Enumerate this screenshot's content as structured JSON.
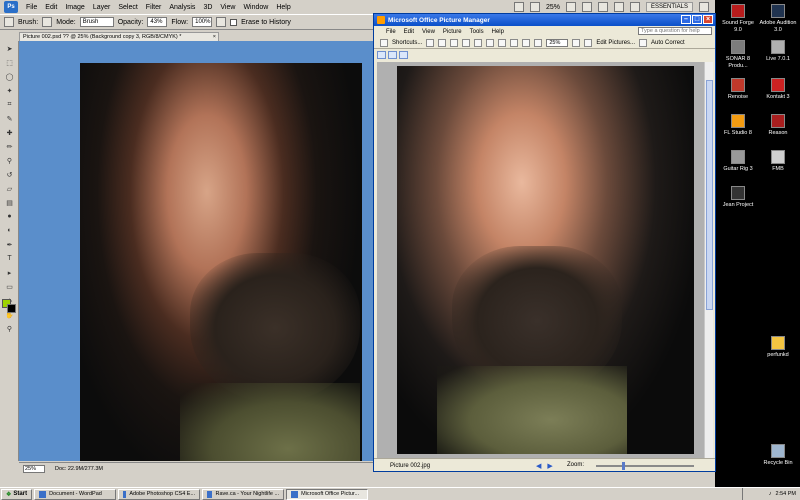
{
  "photoshop": {
    "logo": "Ps",
    "menus": [
      "File",
      "Edit",
      "Image",
      "Layer",
      "Select",
      "Filter",
      "Analysis",
      "3D",
      "View",
      "Window",
      "Help"
    ],
    "zoom": "25%",
    "workspace": "ESSENTIALS",
    "options": {
      "brush_label": "Brush:",
      "mode_label": "Mode:",
      "mode_value": "Brush",
      "opacity_label": "Opacity:",
      "opacity_value": "43%",
      "flow_label": "Flow:",
      "flow_value": "100%",
      "erase_to_history": "Erase to History"
    },
    "doc_tab": "Picture 002.psd ?? @ 25% (Background copy 3, RGB/8/CMYK) *",
    "doc_tab_close": "×",
    "status_zoom": "25%",
    "status_doc": "Doc: 22.9M/277.3M"
  },
  "picture_manager": {
    "title": "Microsoft Office Picture Manager",
    "menus": [
      "File",
      "Edit",
      "View",
      "Picture",
      "Tools",
      "Help"
    ],
    "help_placeholder": "Type a question for help",
    "toolbar": {
      "shortcuts": "Shortcuts...",
      "zoom": "25%",
      "edit_pictures": "Edit Pictures...",
      "auto_correct": "Auto Correct"
    },
    "status_filename": "Picture 002.jpg",
    "zoom_label": "Zoom:",
    "zoom_level": 0.27
  },
  "desktop": {
    "icons": [
      {
        "label": "Sound Forge 9.0",
        "color": "#b71c1c"
      },
      {
        "label": "Adobe Audition 3.0",
        "color": "#20334f"
      },
      {
        "label": "SONAR 8 Produ...",
        "color": "#7c7c7c"
      },
      {
        "label": "Live 7.0.1",
        "color": "#b0b0b0"
      },
      {
        "label": "Renoise",
        "color": "#c0392b"
      },
      {
        "label": "Kontakt 3",
        "color": "#cc2222"
      },
      {
        "label": "FL Studio 8",
        "color": "#f39c12"
      },
      {
        "label": "Reason",
        "color": "#a81e1e"
      },
      {
        "label": "Guitar Rig 3",
        "color": "#999999"
      },
      {
        "label": "FMB",
        "color": "#cfcfcf"
      },
      {
        "label": "Jean Project",
        "color": "#333333"
      },
      {
        "label": "perfunkd",
        "color": "#f4c542"
      },
      {
        "label": "Recycle Bin",
        "color": "#9fb6cf"
      }
    ]
  },
  "taskbar": {
    "start": "Start",
    "tasks": [
      "Document - WordPad",
      "Adobe Photoshop CS4 E...",
      "Rave.ca - Your Nightlife ...",
      "Microsoft Office Pictur..."
    ],
    "clock": "2:54 PM"
  }
}
